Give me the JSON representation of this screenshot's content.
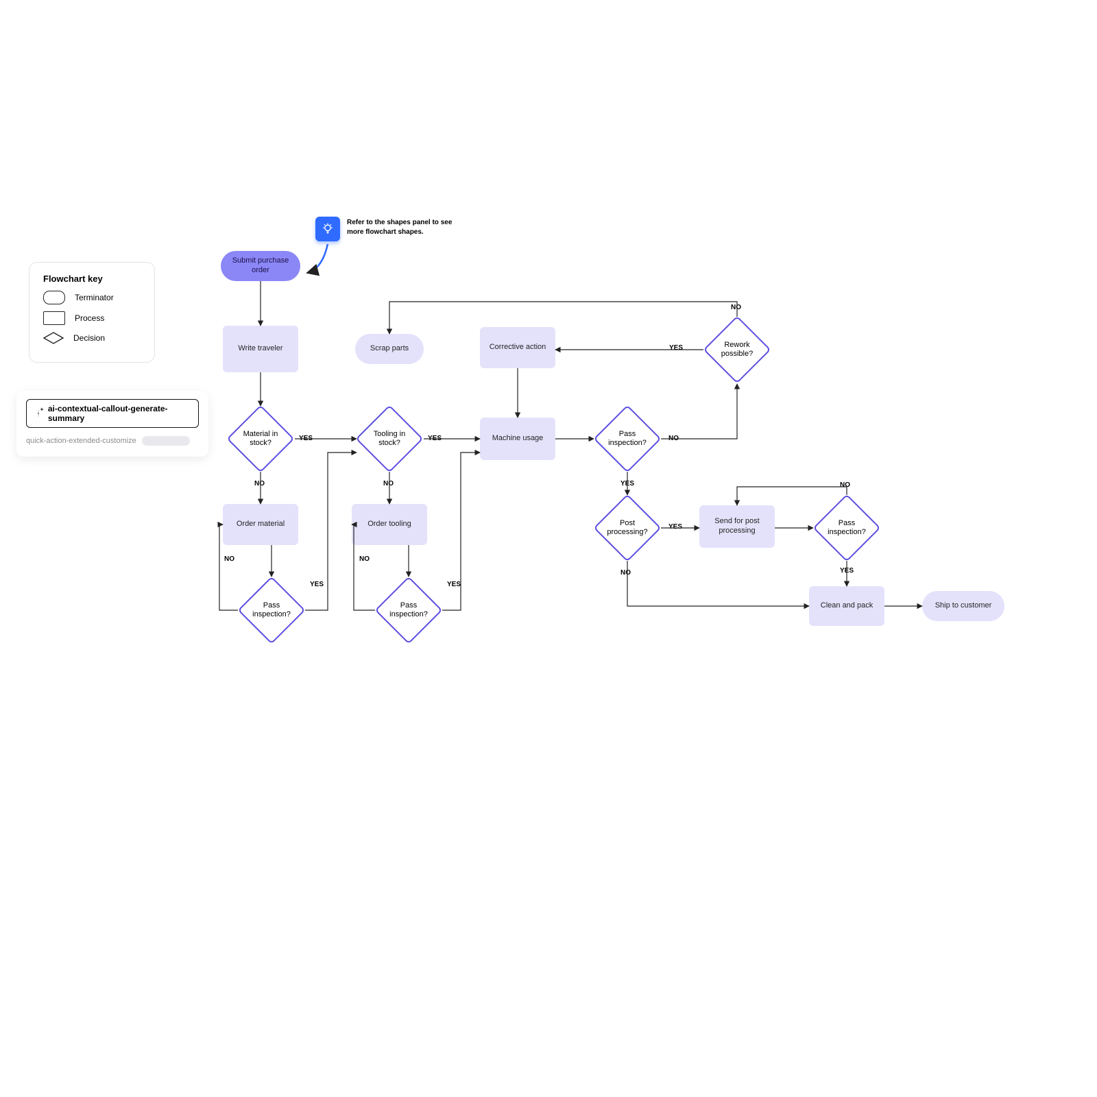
{
  "key": {
    "title": "Flowchart key",
    "terminator": "Terminator",
    "process": "Process",
    "decision": "Decision"
  },
  "ai": {
    "button": "ai-contextual-callout-generate-summary",
    "quick_text": "quick-action-extended-customize"
  },
  "tip": {
    "text": "Refer to the shapes panel to see more flowchart shapes."
  },
  "nodes": {
    "submit": "Submit purchase order",
    "write_traveler": "Write traveler",
    "scrap": "Scrap parts",
    "corrective": "Corrective action",
    "material_stock": "Material in stock?",
    "tooling_stock": "Tooling in stock?",
    "machine_usage": "Machine usage",
    "pass_insp_1": "Pass inspection?",
    "rework": "Rework possible?",
    "order_material": "Order material",
    "order_tooling": "Order tooling",
    "pass_insp_mat": "Pass inspection?",
    "pass_insp_tool": "Pass inspection?",
    "post_proc": "Post processing?",
    "send_post": "Send for post processing",
    "pass_insp_2": "Pass inspection?",
    "clean_pack": "Clean and pack",
    "ship": "Ship to customer"
  },
  "labels": {
    "yes": "YES",
    "no": "NO"
  },
  "chart_data": {
    "type": "flowchart",
    "legend": [
      "Terminator",
      "Process",
      "Decision"
    ],
    "nodes": [
      {
        "id": "submit",
        "type": "terminator",
        "label": "Submit purchase order"
      },
      {
        "id": "write_traveler",
        "type": "process",
        "label": "Write traveler"
      },
      {
        "id": "material_stock",
        "type": "decision",
        "label": "Material in stock?"
      },
      {
        "id": "order_material",
        "type": "process",
        "label": "Order material"
      },
      {
        "id": "pass_insp_mat",
        "type": "decision",
        "label": "Pass inspection?"
      },
      {
        "id": "tooling_stock",
        "type": "decision",
        "label": "Tooling in stock?"
      },
      {
        "id": "order_tooling",
        "type": "process",
        "label": "Order tooling"
      },
      {
        "id": "pass_insp_tool",
        "type": "decision",
        "label": "Pass inspection?"
      },
      {
        "id": "machine_usage",
        "type": "process",
        "label": "Machine usage"
      },
      {
        "id": "corrective",
        "type": "process",
        "label": "Corrective action"
      },
      {
        "id": "scrap",
        "type": "terminator",
        "label": "Scrap parts"
      },
      {
        "id": "pass_insp_1",
        "type": "decision",
        "label": "Pass inspection?"
      },
      {
        "id": "rework",
        "type": "decision",
        "label": "Rework possible?"
      },
      {
        "id": "post_proc",
        "type": "decision",
        "label": "Post processing?"
      },
      {
        "id": "send_post",
        "type": "process",
        "label": "Send for post processing"
      },
      {
        "id": "pass_insp_2",
        "type": "decision",
        "label": "Pass inspection?"
      },
      {
        "id": "clean_pack",
        "type": "process",
        "label": "Clean and pack"
      },
      {
        "id": "ship",
        "type": "terminator",
        "label": "Ship to customer"
      }
    ],
    "edges": [
      {
        "from": "submit",
        "to": "write_traveler"
      },
      {
        "from": "write_traveler",
        "to": "material_stock"
      },
      {
        "from": "material_stock",
        "to": "tooling_stock",
        "label": "YES"
      },
      {
        "from": "material_stock",
        "to": "order_material",
        "label": "NO"
      },
      {
        "from": "order_material",
        "to": "pass_insp_mat"
      },
      {
        "from": "pass_insp_mat",
        "to": "order_material",
        "label": "NO"
      },
      {
        "from": "pass_insp_mat",
        "to": "tooling_stock",
        "label": "YES"
      },
      {
        "from": "tooling_stock",
        "to": "machine_usage",
        "label": "YES"
      },
      {
        "from": "tooling_stock",
        "to": "order_tooling",
        "label": "NO"
      },
      {
        "from": "order_tooling",
        "to": "pass_insp_tool"
      },
      {
        "from": "pass_insp_tool",
        "to": "order_tooling",
        "label": "NO"
      },
      {
        "from": "pass_insp_tool",
        "to": "machine_usage",
        "label": "YES"
      },
      {
        "from": "corrective",
        "to": "machine_usage"
      },
      {
        "from": "machine_usage",
        "to": "pass_insp_1"
      },
      {
        "from": "pass_insp_1",
        "to": "rework",
        "label": "NO"
      },
      {
        "from": "pass_insp_1",
        "to": "post_proc",
        "label": "YES"
      },
      {
        "from": "rework",
        "to": "corrective",
        "label": "YES"
      },
      {
        "from": "rework",
        "to": "scrap",
        "label": "NO"
      },
      {
        "from": "post_proc",
        "to": "send_post",
        "label": "YES"
      },
      {
        "from": "post_proc",
        "to": "clean_pack",
        "label": "NO"
      },
      {
        "from": "send_post",
        "to": "pass_insp_2"
      },
      {
        "from": "pass_insp_2",
        "to": "send_post",
        "label": "NO"
      },
      {
        "from": "pass_insp_2",
        "to": "clean_pack",
        "label": "YES"
      },
      {
        "from": "clean_pack",
        "to": "ship"
      }
    ]
  }
}
